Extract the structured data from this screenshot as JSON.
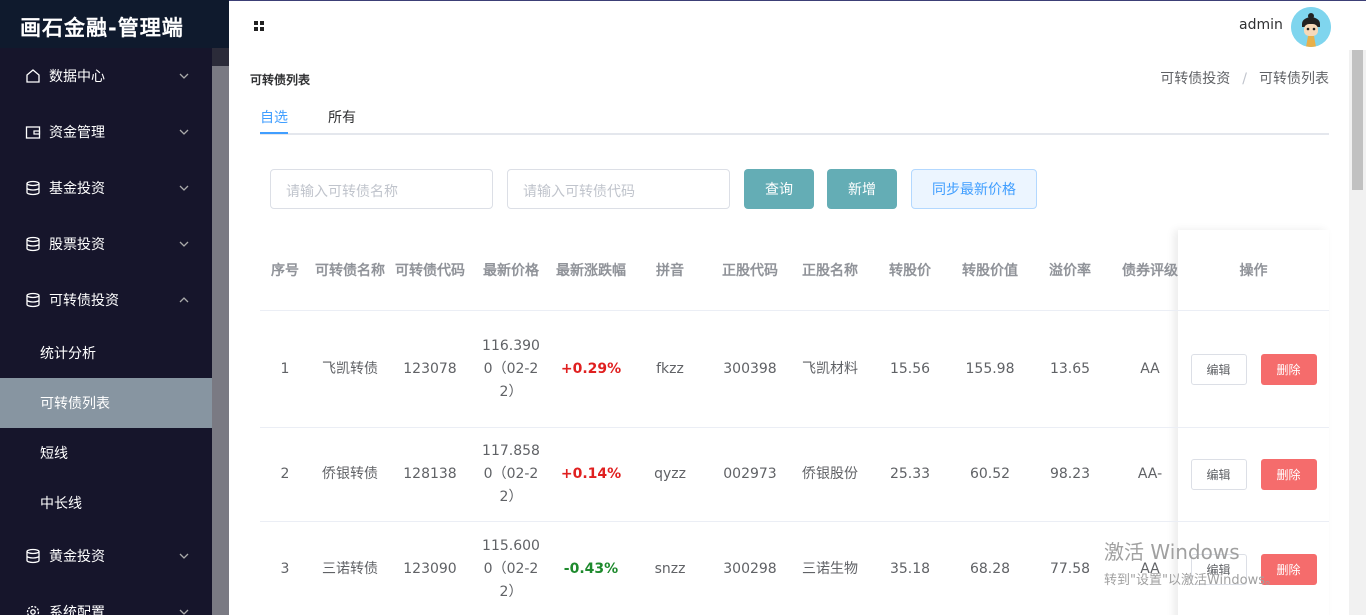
{
  "app": {
    "title": "画石金融-管理端"
  },
  "header": {
    "user": "admin"
  },
  "sidebar": {
    "items": [
      {
        "label": "数据中心"
      },
      {
        "label": "资金管理"
      },
      {
        "label": "基金投资"
      },
      {
        "label": "股票投资"
      },
      {
        "label": "可转债投资"
      }
    ],
    "sub_items": [
      {
        "label": "统计分析"
      },
      {
        "label": "可转债列表"
      },
      {
        "label": "短线"
      },
      {
        "label": "中长线"
      }
    ],
    "items_after": [
      {
        "label": "黄金投资"
      },
      {
        "label": "系统配置"
      }
    ]
  },
  "page": {
    "title": "可转债列表",
    "breadcrumb": [
      "可转债投资",
      "可转债列表"
    ],
    "tabs": [
      "自选",
      "所有"
    ]
  },
  "search": {
    "name_placeholder": "请输入可转债名称",
    "code_placeholder": "请输入可转债代码",
    "query_label": "查询",
    "add_label": "新增",
    "sync_label": "同步最新价格"
  },
  "table": {
    "headers": [
      "序号",
      "可转债名称",
      "可转债代码",
      "最新价格",
      "最新涨跌幅",
      "拼音",
      "正股代码",
      "正股名称",
      "转股价",
      "转股价值",
      "溢价率",
      "债券评级",
      "操作"
    ],
    "rows": [
      {
        "index": "1",
        "name": "飞凯转债",
        "code": "123078",
        "price": "116.3900（02-22）",
        "change": "+0.29%",
        "pinyin": "fkzz",
        "stock_code": "300398",
        "stock_name": "飞凯材料",
        "conv_price": "15.56",
        "conv_value": "155.98",
        "premium": "13.65",
        "rating": "AA"
      },
      {
        "index": "2",
        "name": "侨银转债",
        "code": "128138",
        "price": "117.8580（02-22）",
        "change": "+0.14%",
        "pinyin": "qyzz",
        "stock_code": "002973",
        "stock_name": "侨银股份",
        "conv_price": "25.33",
        "conv_value": "60.52",
        "premium": "98.23",
        "rating": "AA-"
      },
      {
        "index": "3",
        "name": "三诺转债",
        "code": "123090",
        "price": "115.6000（02-22）",
        "change": "-0.43%",
        "pinyin": "snzz",
        "stock_code": "300298",
        "stock_name": "三诺生物",
        "conv_price": "35.18",
        "conv_value": "68.28",
        "premium": "77.58",
        "rating": "AA"
      }
    ],
    "edit_label": "编辑",
    "delete_label": "删除"
  },
  "watermark": {
    "line1": "激活 Windows",
    "line2": "转到\"设置\"以激活Windows。"
  },
  "colors": {
    "accent": "#409eff",
    "teal": "#64adb5",
    "danger": "#f56c6c",
    "sidebar": "#16152b",
    "up": "#e02020",
    "down": "#1e8a2d"
  }
}
